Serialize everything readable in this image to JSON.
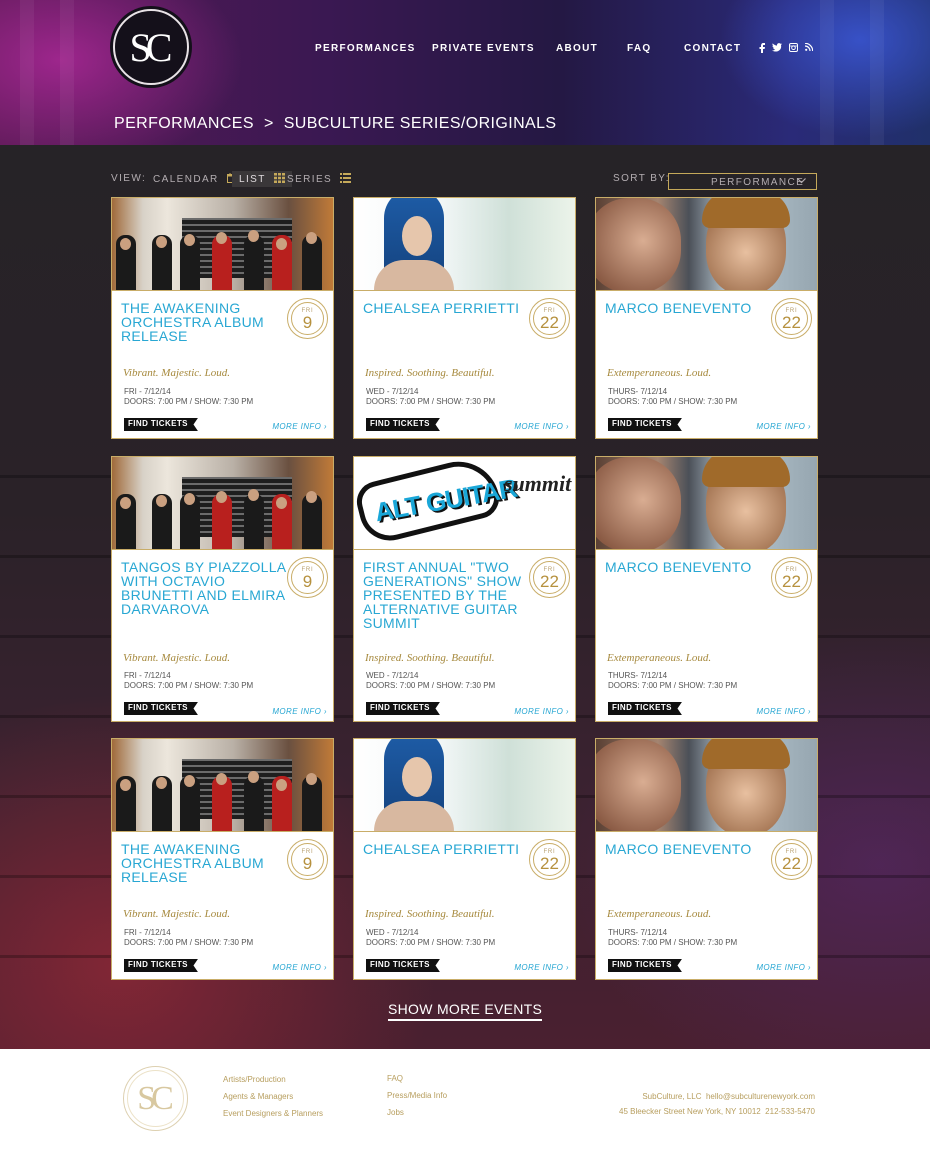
{
  "brand": {
    "logo_text": "SC"
  },
  "nav": [
    "PERFORMANCES",
    "PRIVATE EVENTS",
    "ABOUT",
    "FAQ",
    "CONTACT"
  ],
  "social": {
    "facebook": "f",
    "twitter": "t",
    "instagram": "ig",
    "rss": "rss"
  },
  "breadcrumb": {
    "parent": "PERFORMANCES",
    "separator": ">",
    "current": "SUBCULTURE SERIES/ORIGINALS"
  },
  "toolbar": {
    "view_label": "VIEW:",
    "calendar": "CALENDAR",
    "list": "LIST",
    "series": "SERIES",
    "sort_label": "SORT BY:",
    "sort_value": "PERFORMANCE"
  },
  "colors": {
    "accent_blue": "#28a7d3",
    "gold": "#c9ad68",
    "ticket_black": "#101010"
  },
  "events": [
    {
      "title": "THE AWAKENING ORCHESTRA ALBUM RELEASE",
      "dow": "FRI",
      "day": "9",
      "tagline": "Vibrant. Majestic. Loud.",
      "date_line": "FRI - 7/12/14",
      "doors_line": "DOORS: 7:00 PM / SHOW: 7:30 PM",
      "tickets": "FIND TICKETS",
      "more": "MORE INFO"
    },
    {
      "title": "CHEALSEA PERRIETTI",
      "dow": "FRI",
      "day": "22",
      "tagline": "Inspired. Soothing. Beautiful.",
      "date_line": "WED - 7/12/14",
      "doors_line": "DOORS: 7:00 PM / SHOW: 7:30 PM",
      "tickets": "FIND TICKETS",
      "more": "MORE INFO"
    },
    {
      "title": "MARCO BENEVENTO",
      "dow": "FRI",
      "day": "22",
      "tagline": "Extemperaneous. Loud.",
      "date_line": "THURS- 7/12/14",
      "doors_line": "DOORS: 7:00 PM / SHOW: 7:30 PM",
      "tickets": "FIND TICKETS",
      "more": "MORE INFO"
    },
    {
      "title": "TANGOS BY PIAZZOLLA WITH OCTAVIO BRUNETTI AND ELMIRA DARVAROVA",
      "dow": "FRI",
      "day": "9",
      "tagline": "Vibrant. Majestic. Loud.",
      "date_line": "FRI - 7/12/14",
      "doors_line": "DOORS: 7:00 PM / SHOW: 7:30 PM",
      "tickets": "FIND TICKETS",
      "more": "MORE INFO"
    },
    {
      "title": "FIRST ANNUAL \"TWO GENERATIONS\" SHOW PRESENTED BY THE ALTERNATIVE GUITAR SUMMIT",
      "dow": "FRI",
      "day": "22",
      "tagline": "Inspired. Soothing. Beautiful.",
      "date_line": "WED - 7/12/14",
      "doors_line": "DOORS: 7:00 PM / SHOW: 7:30 PM",
      "tickets": "FIND TICKETS",
      "more": "MORE INFO",
      "image_text": [
        "ALT GUITAR",
        "summit"
      ]
    },
    {
      "title": "MARCO BENEVENTO",
      "dow": "FRI",
      "day": "22",
      "tagline": "Extemperaneous. Loud.",
      "date_line": "THURS- 7/12/14",
      "doors_line": "DOORS: 7:00 PM / SHOW: 7:30 PM",
      "tickets": "FIND TICKETS",
      "more": "MORE INFO"
    },
    {
      "title": "THE AWAKENING ORCHESTRA ALBUM RELEASE",
      "dow": "FRI",
      "day": "9",
      "tagline": "Vibrant. Majestic. Loud.",
      "date_line": "FRI - 7/12/14",
      "doors_line": "DOORS: 7:00 PM / SHOW: 7:30 PM",
      "tickets": "FIND TICKETS",
      "more": "MORE INFO"
    },
    {
      "title": "CHEALSEA PERRIETTI",
      "dow": "FRI",
      "day": "22",
      "tagline": "Inspired. Soothing. Beautiful.",
      "date_line": "WED - 7/12/14",
      "doors_line": "DOORS: 7:00 PM / SHOW: 7:30 PM",
      "tickets": "FIND TICKETS",
      "more": "MORE INFO"
    },
    {
      "title": "MARCO BENEVENTO",
      "dow": "FRI",
      "day": "22",
      "tagline": "Extemperaneous. Loud.",
      "date_line": "THURS- 7/12/14",
      "doors_line": "DOORS: 7:00 PM / SHOW: 7:30 PM",
      "tickets": "FIND TICKETS",
      "more": "MORE INFO"
    }
  ],
  "show_more": "SHOW MORE EVENTS",
  "footer": {
    "logo_text": "SC",
    "col1": [
      "Artists/Production",
      "Agents & Managers",
      "Event Designers & Planners"
    ],
    "col2": [
      "FAQ",
      "Press/Media Info",
      "Jobs"
    ],
    "company": "SubCulture, LLC",
    "email": "hello@subculturenewyork.com",
    "address": "45 Bleecker Street New York, NY 10012",
    "phone": "212-533-5470"
  }
}
